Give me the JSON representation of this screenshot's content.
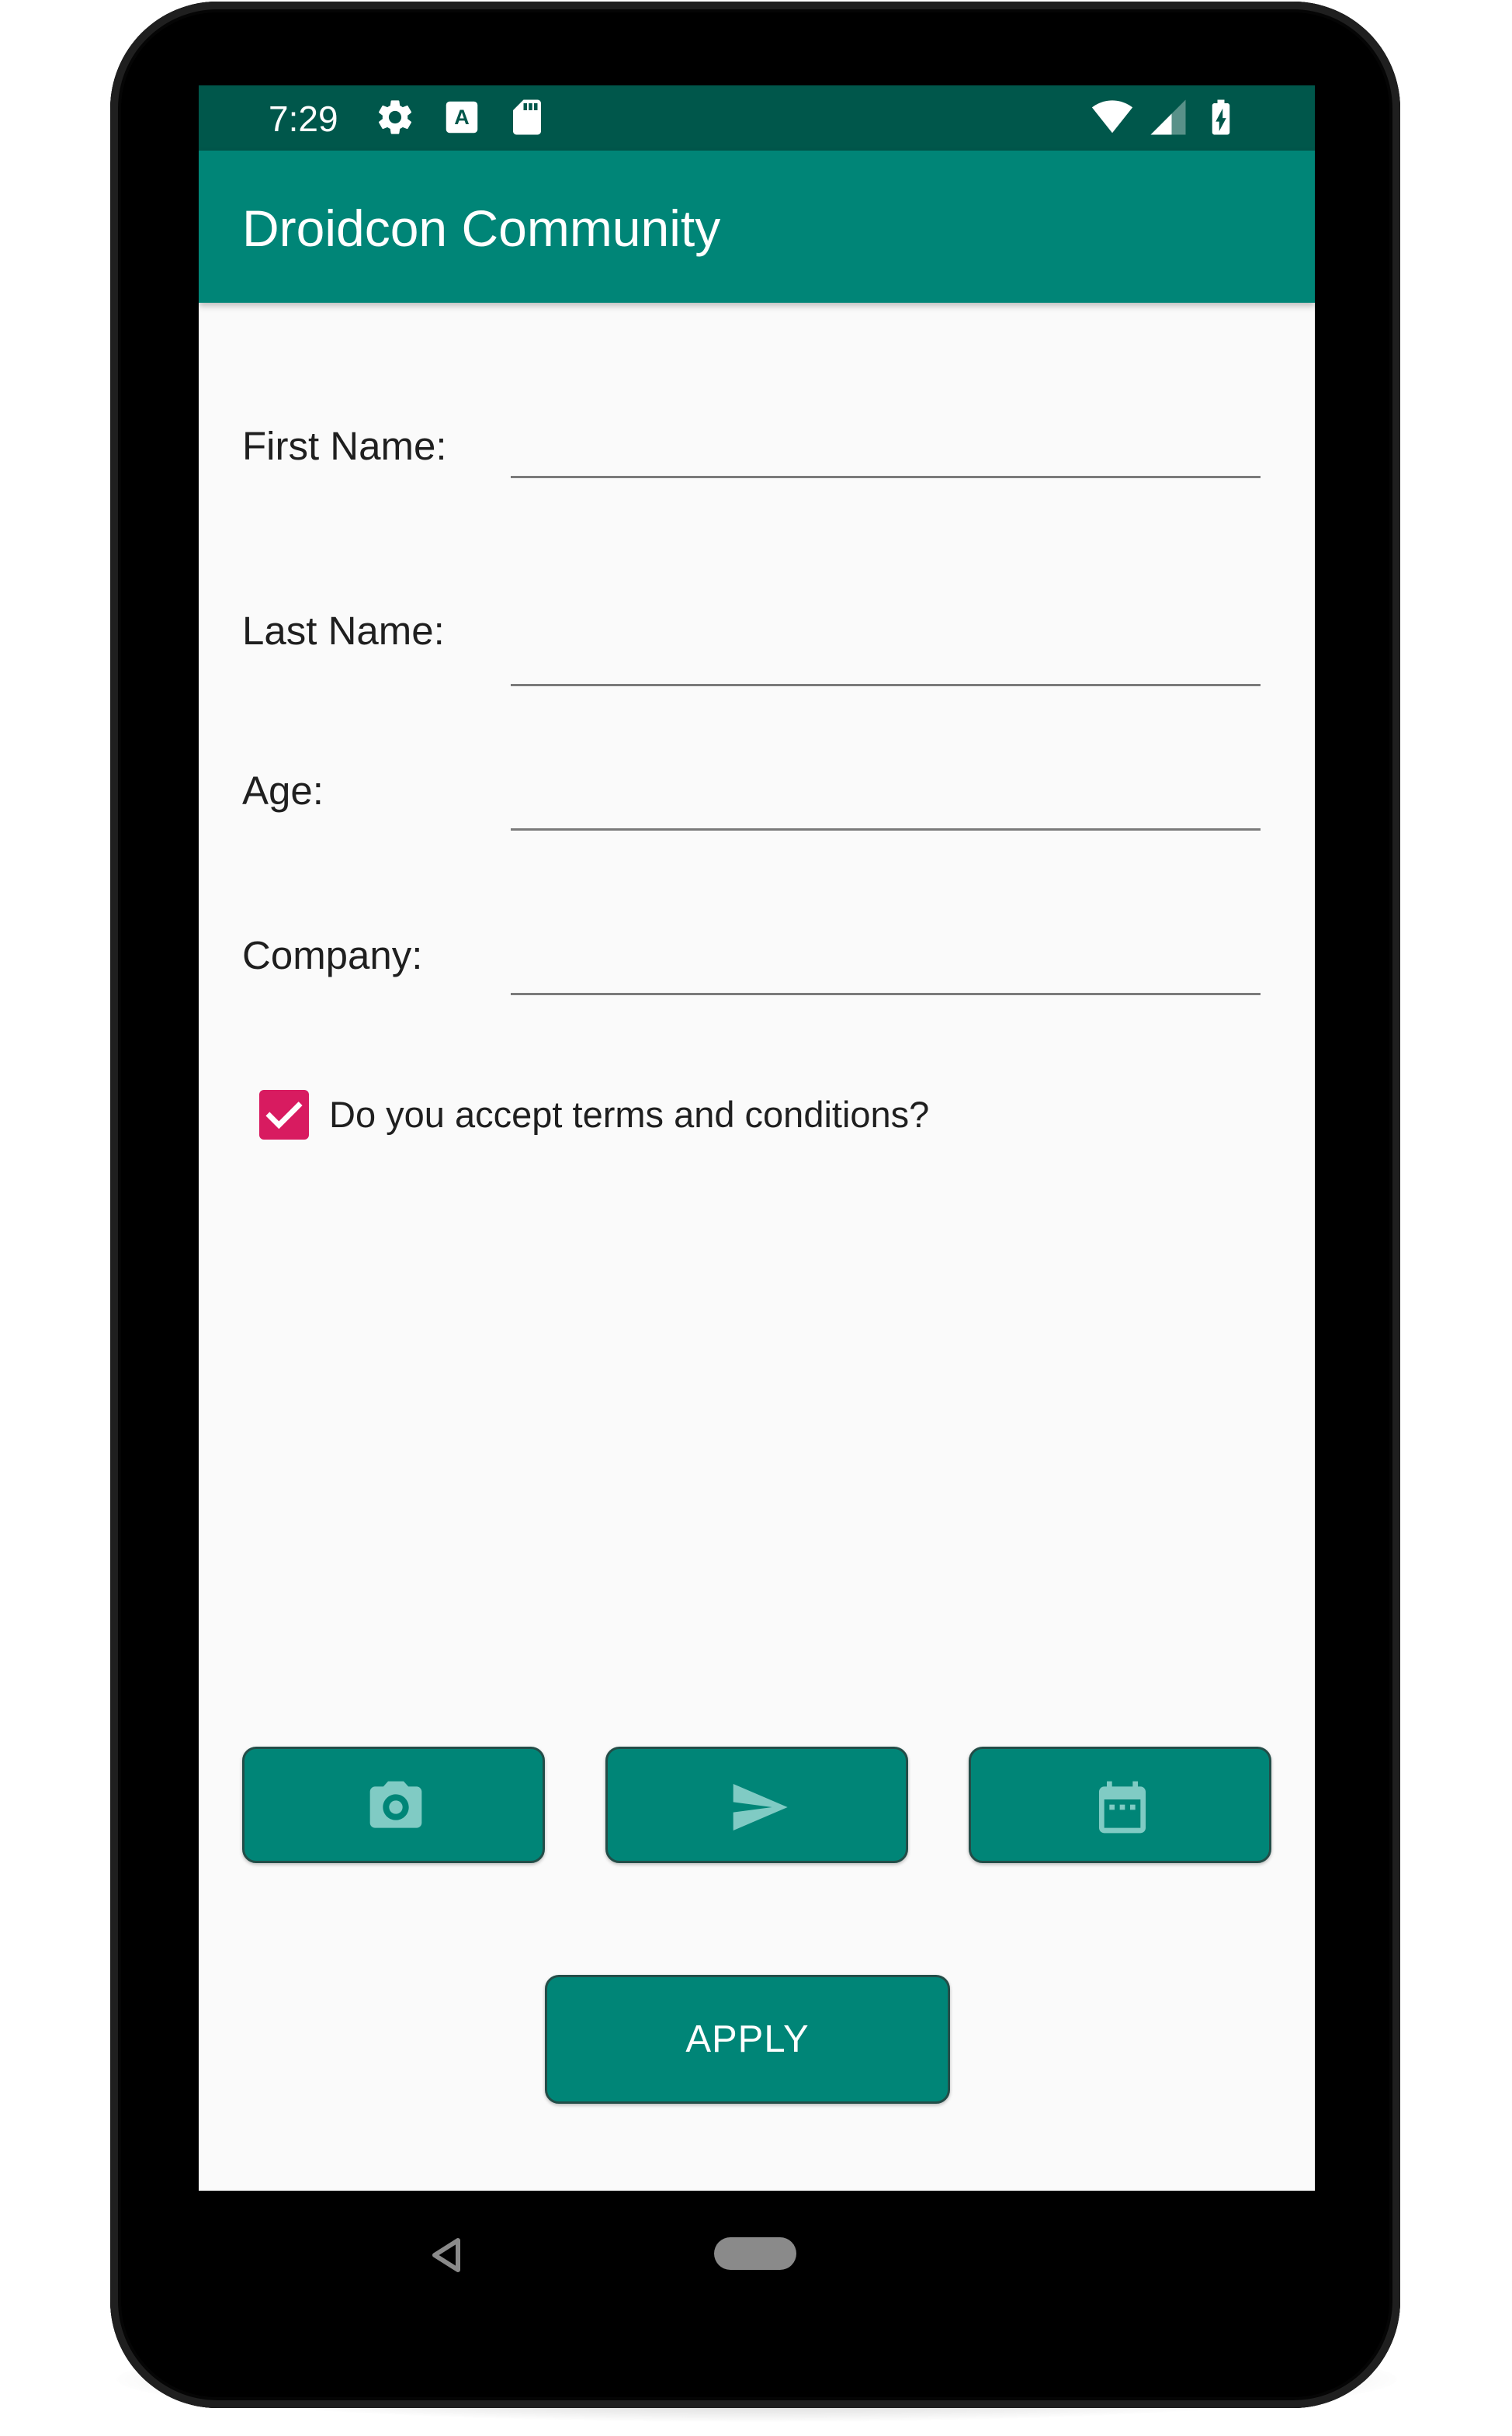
{
  "status_bar": {
    "time": "7:29",
    "icons": [
      "settings-icon",
      "keyboard-a-icon",
      "sd-card-icon",
      "wifi-icon",
      "cell-signal-icon",
      "battery-charging-icon"
    ]
  },
  "app_bar": {
    "title": "Droidcon Community"
  },
  "form": {
    "first_name": {
      "label": "First Name:",
      "value": ""
    },
    "last_name": {
      "label": "Last Name:",
      "value": ""
    },
    "age": {
      "label": "Age:",
      "value": ""
    },
    "company": {
      "label": "Company:",
      "value": ""
    },
    "terms": {
      "label": "Do you accept terms and conditions?",
      "checked": true
    }
  },
  "actions": {
    "icon_buttons": [
      "camera-icon",
      "send-icon",
      "calendar-icon"
    ],
    "apply_label": "APPLY"
  },
  "nav_bar": {
    "icons": [
      "back-icon",
      "home-pill"
    ]
  },
  "colors": {
    "status_bar": "#00574b",
    "primary": "#008577",
    "accent": "#d81b60",
    "background": "#fafafa",
    "icon_tint": "#80cbc4"
  }
}
